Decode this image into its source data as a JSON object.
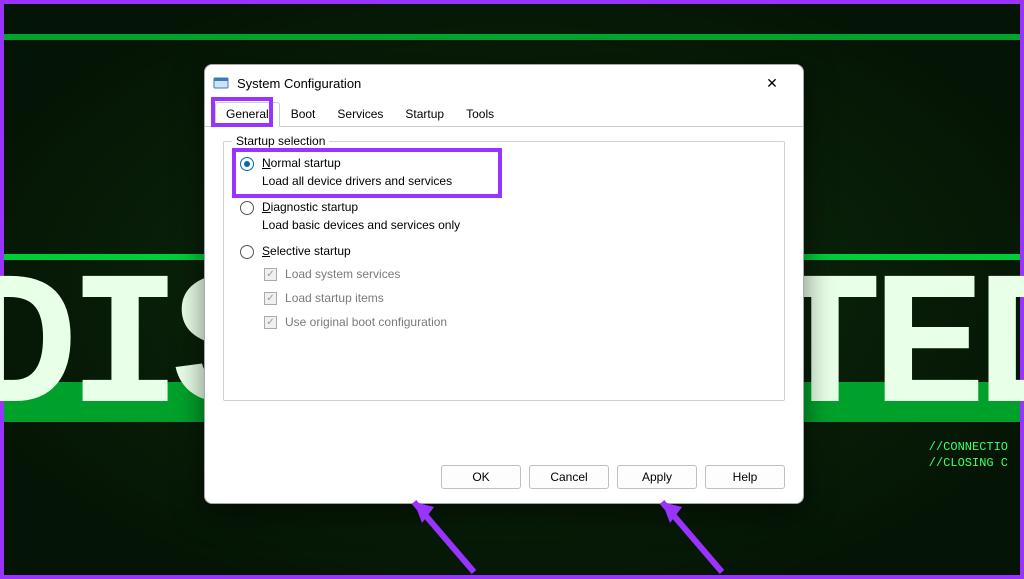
{
  "background": {
    "big_text_left": "DIS",
    "big_text_right": "TED",
    "small_line1": "//CONNECTIO",
    "small_line2": "//CLOSING C"
  },
  "dialog": {
    "title": "System Configuration",
    "close_glyph": "✕",
    "tabs": [
      "General",
      "Boot",
      "Services",
      "Startup",
      "Tools"
    ],
    "active_tab_index": 0,
    "group_legend": "Startup selection",
    "options": {
      "normal": {
        "label": "Normal startup",
        "underline_char": "N",
        "sub": "Load all device drivers and services",
        "selected": true
      },
      "diagnostic": {
        "label": "Diagnostic startup",
        "underline_char": "D",
        "sub": "Load basic devices and services only",
        "selected": false
      },
      "selective": {
        "label": "Selective startup",
        "underline_char": "S",
        "selected": false
      }
    },
    "checkboxes": {
      "load_system": {
        "label": "Load system services",
        "underline_char": "L",
        "checked": true,
        "disabled": true
      },
      "load_startup": {
        "label": "Load startup items",
        "underline_char": "o",
        "checked": true,
        "disabled": true
      },
      "use_original": {
        "label": "Use original boot configuration",
        "underline_char": "U",
        "checked": true,
        "disabled": true
      }
    },
    "buttons": {
      "ok": "OK",
      "cancel": "Cancel",
      "apply": "Apply",
      "help": "Help"
    }
  },
  "annotations": {
    "highlight_color": "#9933ff"
  }
}
